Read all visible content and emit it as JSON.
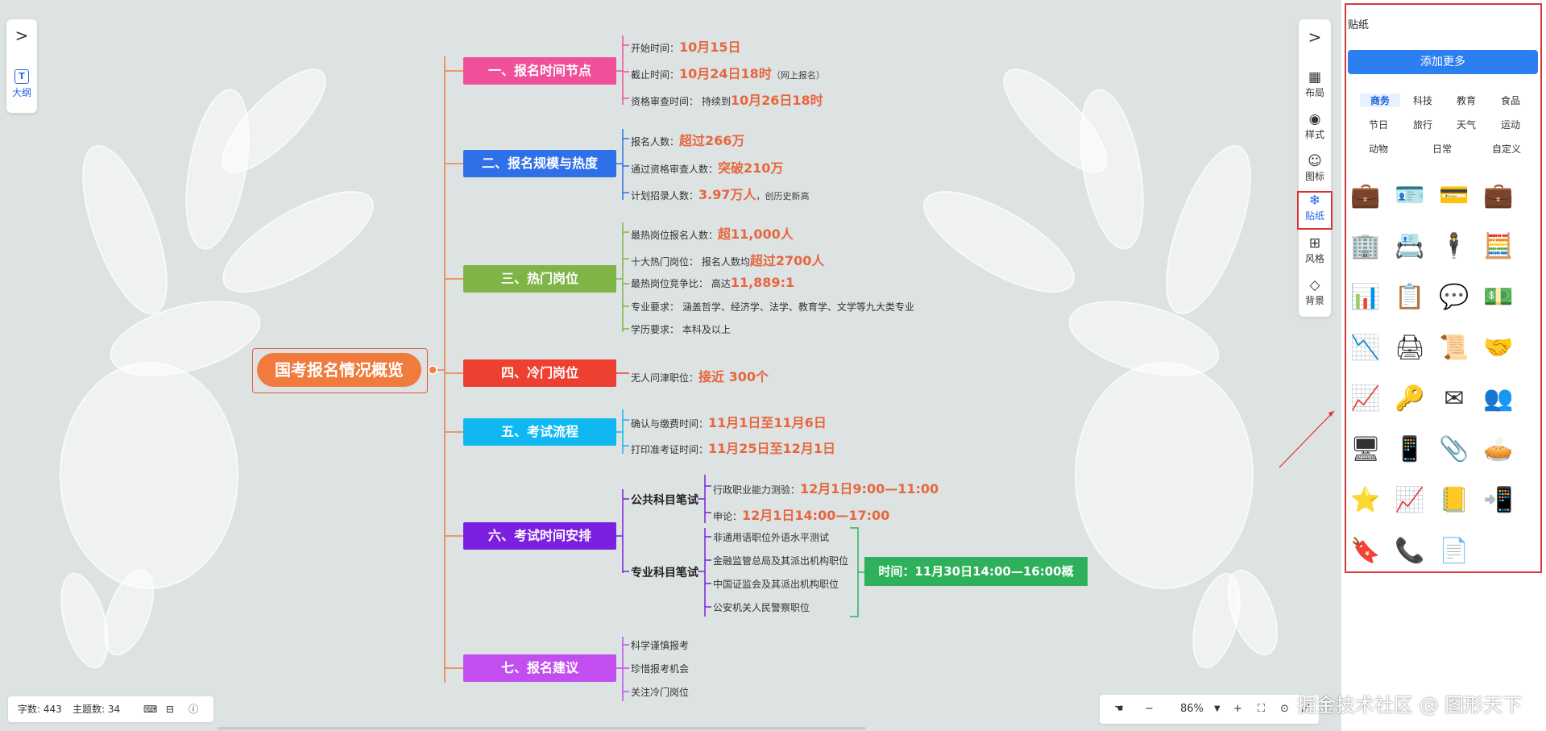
{
  "left_tool": {
    "expand_icon": ">",
    "outline_label": "大纲"
  },
  "right_tool": {
    "expand_icon": ">",
    "items": [
      {
        "label": "布局",
        "icon": "layout-icon"
      },
      {
        "label": "样式",
        "icon": "palette-icon"
      },
      {
        "label": "图标",
        "icon": "smile-icon"
      },
      {
        "label": "贴纸",
        "icon": "snowflake-icon",
        "active": true
      },
      {
        "label": "风格",
        "icon": "grid-icon"
      },
      {
        "label": "背景",
        "icon": "layers-icon"
      }
    ]
  },
  "sticker_panel": {
    "title": "贴纸",
    "add_more": "添加更多",
    "categories": [
      "商务",
      "科技",
      "教育",
      "食品",
      "节日",
      "旅行",
      "天气",
      "运动",
      "动物",
      "日常",
      "自定义"
    ],
    "selected_category": "商务",
    "stickers": [
      "briefcase-clock",
      "id-card",
      "credit-cards",
      "briefcase",
      "office-building",
      "business-card",
      "businessman",
      "calculator",
      "candlestick-chart",
      "resume",
      "chat-bubbles",
      "money-stack",
      "declining-chart",
      "printer",
      "contract",
      "handshake",
      "growth-arrow",
      "keys",
      "envelope",
      "meeting",
      "presentation-screen",
      "mobile-payment",
      "paperclip",
      "pie-chart",
      "puzzle-star",
      "line-graph",
      "notepad",
      "qr-phone",
      "stamp",
      "phone-call",
      "document-stamp"
    ]
  },
  "mindmap": {
    "root": "国考报名情况概览",
    "topics": [
      {
        "label": "一、报名时间节点",
        "color": "#f0509a",
        "leaves": [
          {
            "label": "开始时间：",
            "value": "10月15日",
            "note": ""
          },
          {
            "label": "截止时间：",
            "value": "10月24日18时",
            "note": "（网上报名）"
          },
          {
            "label": "资格审查时间：  持续到",
            "value": "10月26日18时",
            "note": ""
          }
        ]
      },
      {
        "label": "二、报名规模与热度",
        "color": "#2f6fe8",
        "leaves": [
          {
            "label": "报名人数：",
            "value": "超过266万",
            "note": ""
          },
          {
            "label": "通过资格审查人数：",
            "value": "突破210万",
            "note": ""
          },
          {
            "label": "计划招录人数：",
            "value": "3.97万人",
            "note": "，创历史新高"
          }
        ]
      },
      {
        "label": "三、热门岗位",
        "color": "#7fb547",
        "leaves": [
          {
            "label": "最热岗位报名人数：",
            "value": "超11,000人",
            "note": ""
          },
          {
            "label": "十大热门岗位：  报名人数均",
            "value": "超过2700人",
            "note": ""
          },
          {
            "label": "最热岗位竞争比：  高达",
            "value": "11,889:1",
            "note": ""
          },
          {
            "label": "专业要求：  涵盖哲学、经济学、法学、教育学、文学等九大类专业",
            "value": "",
            "note": ""
          },
          {
            "label": "学历要求：  本科及以上",
            "value": "",
            "note": ""
          }
        ]
      },
      {
        "label": "四、冷门岗位",
        "color": "#ee4030",
        "leaves": [
          {
            "label": "无人问津职位：",
            "value": "接近 300个",
            "note": ""
          }
        ]
      },
      {
        "label": "五、考试流程",
        "color": "#0fb8f0",
        "leaves": [
          {
            "label": "确认与缴费时间：",
            "value": "11月1日至11月6日",
            "note": ""
          },
          {
            "label": "打印准考证时间：",
            "value": "11月25日至12月1日",
            "note": ""
          }
        ]
      },
      {
        "label": "六、考试时间安排",
        "color": "#7b1fe0",
        "subtopics": [
          {
            "label": "公共科目笔试",
            "leaves": [
              {
                "label": "行政职业能力测验：",
                "value": "12月1日9:00—11:00"
              },
              {
                "label": "申论：",
                "value": "12月1日14:00—17:00"
              }
            ]
          },
          {
            "label": "专业科目笔试",
            "leaves": [
              {
                "label": "非通用语职位外语水平测试",
                "value": ""
              },
              {
                "label": "金融监管总局及其派出机构职位",
                "value": ""
              },
              {
                "label": "中国证监会及其派出机构职位",
                "value": ""
              },
              {
                "label": "公安机关人民警察职位",
                "value": ""
              }
            ],
            "summary": "时间：11月30日14:00—16:00概"
          }
        ]
      },
      {
        "label": "七、报名建议",
        "color": "#c24ef0",
        "leaves": [
          {
            "label": "科学谨慎报考",
            "value": "",
            "note": ""
          },
          {
            "label": "珍惜报考机会",
            "value": "",
            "note": ""
          },
          {
            "label": "关注冷门岗位",
            "value": "",
            "note": ""
          }
        ]
      }
    ]
  },
  "status": {
    "word_count": "字数: 443",
    "topic_count": "主题数: 34"
  },
  "zoom": {
    "value": "86%"
  },
  "watermark": "掘金技术社区 @ 图形天下"
}
